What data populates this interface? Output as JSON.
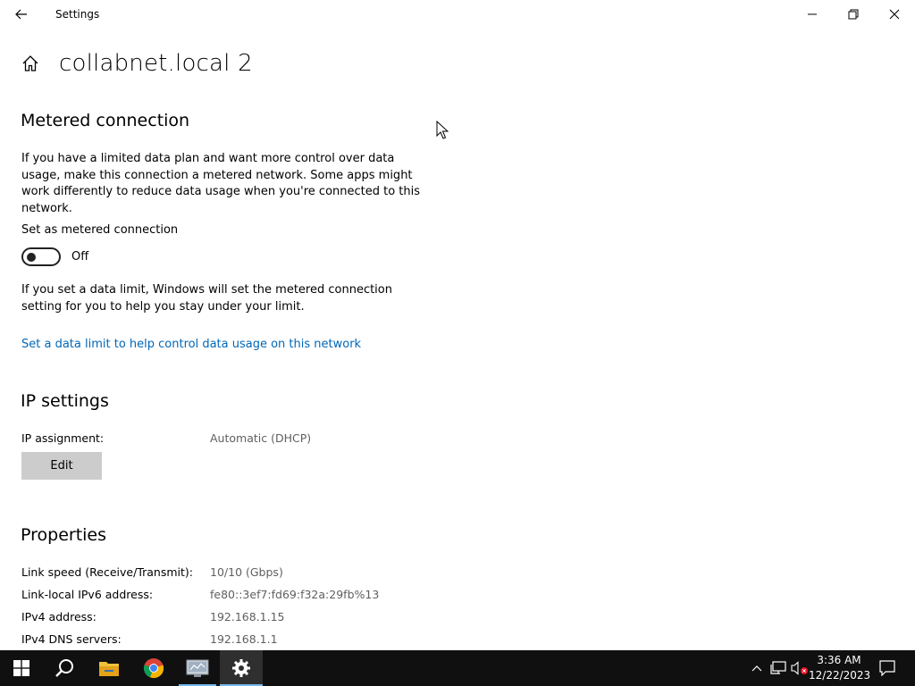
{
  "window": {
    "title": "Settings",
    "page_title": "collabnet.local 2"
  },
  "metered": {
    "heading": "Metered connection",
    "description": "If you have a limited data plan and want more control over data usage, make this connection a metered network. Some apps might work differently to reduce data usage when you're connected to this network.",
    "toggle_label": "Set as metered connection",
    "toggle_state": "Off",
    "toggle_on": false,
    "limit_description": "If you set a data limit, Windows will set the metered connection setting for you to help you stay under your limit.",
    "limit_link": "Set a data limit to help control data usage on this network"
  },
  "ip_settings": {
    "heading": "IP settings",
    "assignment_label": "IP assignment:",
    "assignment_value": "Automatic (DHCP)",
    "edit_label": "Edit"
  },
  "properties": {
    "heading": "Properties",
    "rows": [
      {
        "key": "Link speed (Receive/Transmit):",
        "value": "10/10 (Gbps)"
      },
      {
        "key": "Link-local IPv6 address:",
        "value": "fe80::3ef7:fd69:f32a:29fb%13"
      },
      {
        "key": "IPv4 address:",
        "value": "192.168.1.15"
      },
      {
        "key": "IPv4 DNS servers:",
        "value": "192.168.1.1"
      }
    ]
  },
  "taskbar": {
    "apps": [
      "start-icon",
      "search-icon",
      "file-explorer-icon",
      "chrome-icon",
      "network-app-icon",
      "settings-icon"
    ],
    "time": "3:36 AM",
    "date": "12/22/2023"
  },
  "colors": {
    "link": "#0067b8",
    "taskbar": "#101010",
    "active_underline": "#76b9ed",
    "button": "#cccccc"
  }
}
